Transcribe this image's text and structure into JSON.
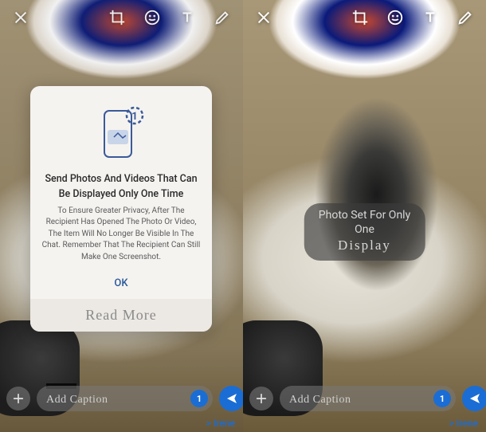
{
  "toolbar": {
    "close": "close-icon",
    "crop": "crop-icon",
    "emoji": "emoji-icon",
    "text": "text-icon",
    "draw": "pencil-icon"
  },
  "dialog": {
    "title": "Send Photos And Videos That Can Be Displayed Only One Time",
    "body": "To Ensure Greater Privacy, After The Recipient Has Opened The Photo Or Video, The Item Will No Longer Be Visible In The Chat. Remember That The Recipient Can Still Make One Screenshot.",
    "ok": "OK",
    "footer": "Read More"
  },
  "toast": {
    "line1": "Photo Set For Only One",
    "line2": "Display"
  },
  "caption": {
    "placeholder": "Add Caption",
    "view_once_badge": "1"
  },
  "recipient": {
    "prefix": "> ",
    "name": "Irene"
  }
}
